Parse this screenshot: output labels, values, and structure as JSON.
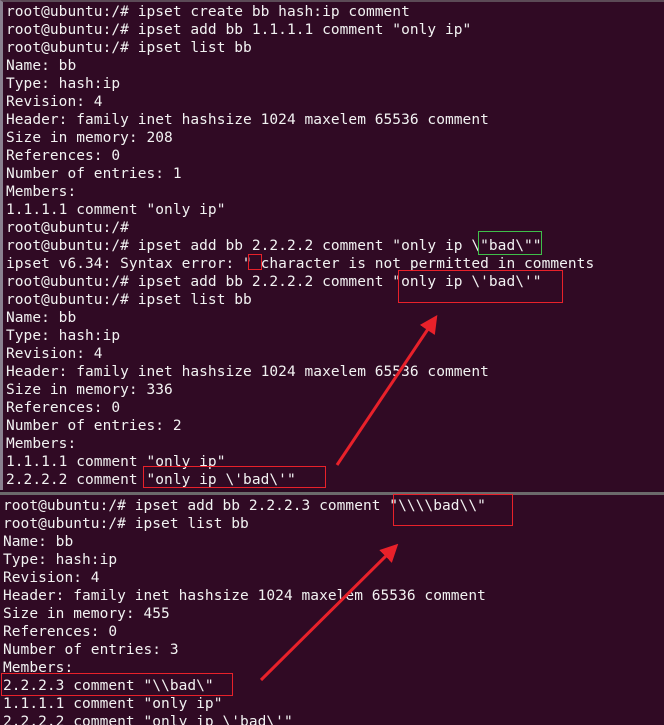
{
  "top_terminal": {
    "lines": [
      "root@ubuntu:/# ipset create bb hash:ip comment",
      "root@ubuntu:/# ipset add bb 1.1.1.1 comment \"only ip\"",
      "root@ubuntu:/# ipset list bb",
      "Name: bb",
      "Type: hash:ip",
      "Revision: 4",
      "Header: family inet hashsize 1024 maxelem 65536 comment",
      "Size in memory: 208",
      "References: 0",
      "Number of entries: 1",
      "Members:",
      "1.1.1.1 comment \"only ip\"",
      "root@ubuntu:/#",
      "root@ubuntu:/# ipset add bb 2.2.2.2 comment \"only ip \\\"bad\\\"\"",
      "ipset v6.34: Syntax error: \" character is not permitted in comments",
      "root@ubuntu:/# ipset add bb 2.2.2.2 comment \"only ip \\'bad\\'\"",
      "root@ubuntu:/# ipset list bb",
      "Name: bb",
      "Type: hash:ip",
      "Revision: 4",
      "Header: family inet hashsize 1024 maxelem 65536 comment",
      "Size in memory: 336",
      "References: 0",
      "Number of entries: 2",
      "Members:",
      "1.1.1.1 comment \"only ip\"",
      "2.2.2.2 comment \"only ip \\'bad\\'\""
    ]
  },
  "bottom_terminal": {
    "lines": [
      "root@ubuntu:/# ipset add bb 2.2.2.3 comment \"\\\\\\\\bad\\\\\"",
      "root@ubuntu:/# ipset list bb",
      "Name: bb",
      "Type: hash:ip",
      "Revision: 4",
      "Header: family inet hashsize 1024 maxelem 65536 comment",
      "Size in memory: 455",
      "References: 0",
      "Number of entries: 3",
      "Members:",
      "2.2.2.3 comment \"\\\\bad\\\"",
      "1.1.1.1 comment \"only ip\"",
      "2.2.2.2 comment \"only ip \\'bad\\'\""
    ]
  },
  "annotations": {
    "highlight_colors": {
      "red": "#e8212a",
      "green": "#3fbf4a"
    },
    "arrow_color": "#e8212a",
    "highlighted_texts": [
      {
        "color": "green",
        "text": "\\\"bad\\\""
      },
      {
        "color": "red",
        "text": "\""
      },
      {
        "color": "red",
        "text": "\"only ip \\'bad\\'\""
      },
      {
        "color": "red",
        "text": "\"only ip \\'bad\\'\""
      },
      {
        "color": "red",
        "text": "\"\\\\\\\\bad\\\\\""
      },
      {
        "color": "red",
        "text": "2.2.2.3 comment \"\\\\bad\\\""
      }
    ]
  }
}
